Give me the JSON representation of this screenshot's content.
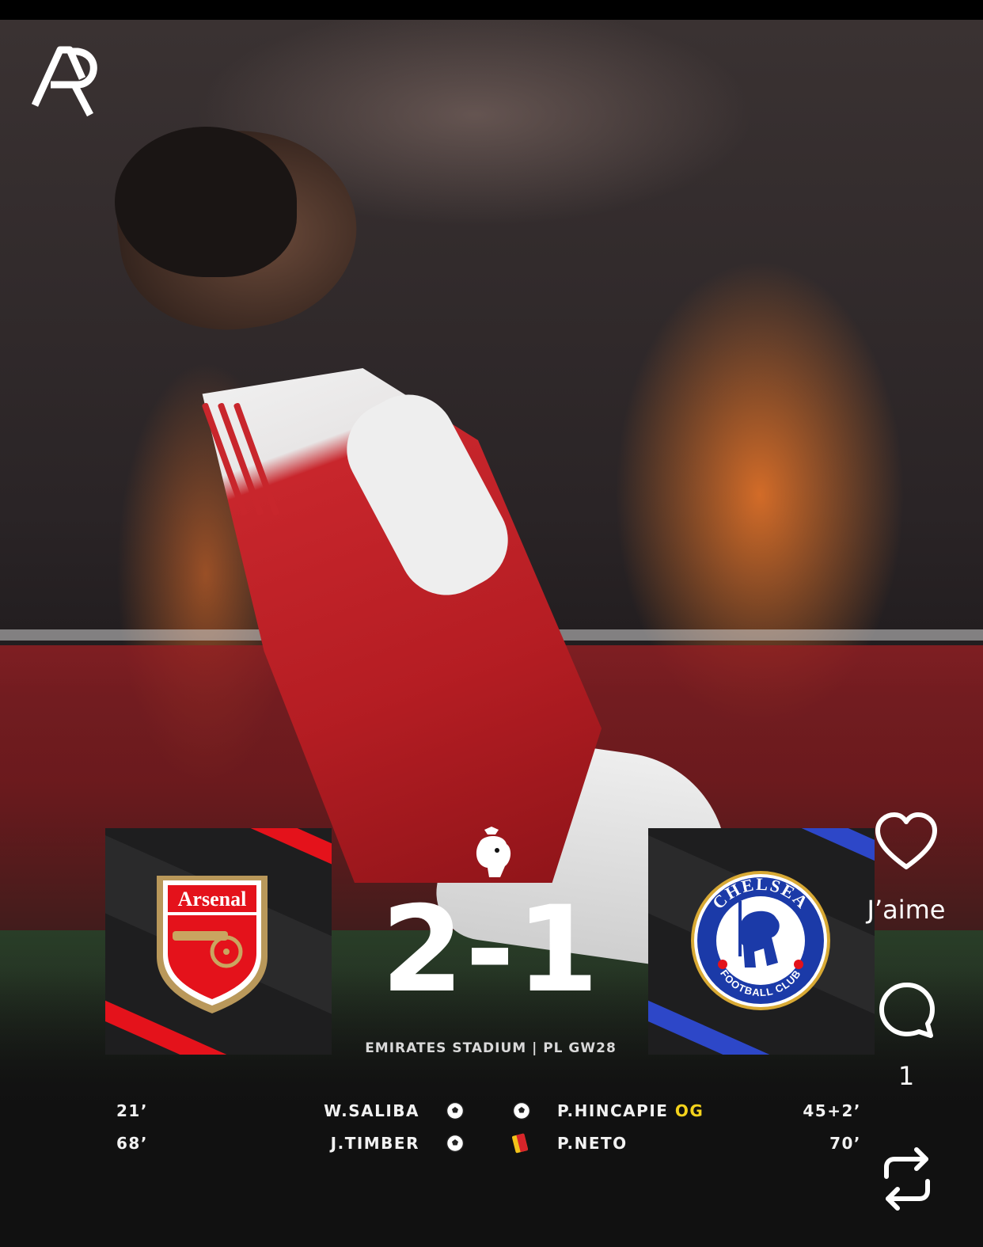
{
  "post": {
    "brand_logo": "AR",
    "match": {
      "home": {
        "team": "Arsenal",
        "crest_text": "Arsenal",
        "accent": "#e4121b"
      },
      "away": {
        "team": "Chelsea",
        "crest_text_top": "CHELSEA",
        "crest_text_bottom": "FOOTBALL CLUB",
        "accent": "#2d47c8"
      },
      "score": "2-1",
      "venue": "EMIRATES STADIUM | PL GW28",
      "competition_icon": "premier-league-lion-icon"
    },
    "events": {
      "home": [
        {
          "minute": "21’",
          "player": "W.SALIBA",
          "icon": "ball-icon"
        },
        {
          "minute": "68’",
          "player": "J.TIMBER",
          "icon": "ball-icon"
        }
      ],
      "away": [
        {
          "minute": "45+2’",
          "player": "P.HINCAPIE",
          "tag": "OG",
          "icon": "ball-icon"
        },
        {
          "minute": "70’",
          "player": "P.NETO",
          "icon": "yellow-red-card-icon"
        }
      ]
    }
  },
  "actions": {
    "like_label": "J’aime",
    "comment_count": "1",
    "icons": [
      "heart-icon",
      "comment-icon",
      "repost-icon"
    ]
  },
  "colors": {
    "og_highlight": "#f4d31c",
    "panel_bg": "#1e1e1f",
    "arsenal_red": "#e4121b",
    "chelsea_blue": "#2d47c8"
  }
}
